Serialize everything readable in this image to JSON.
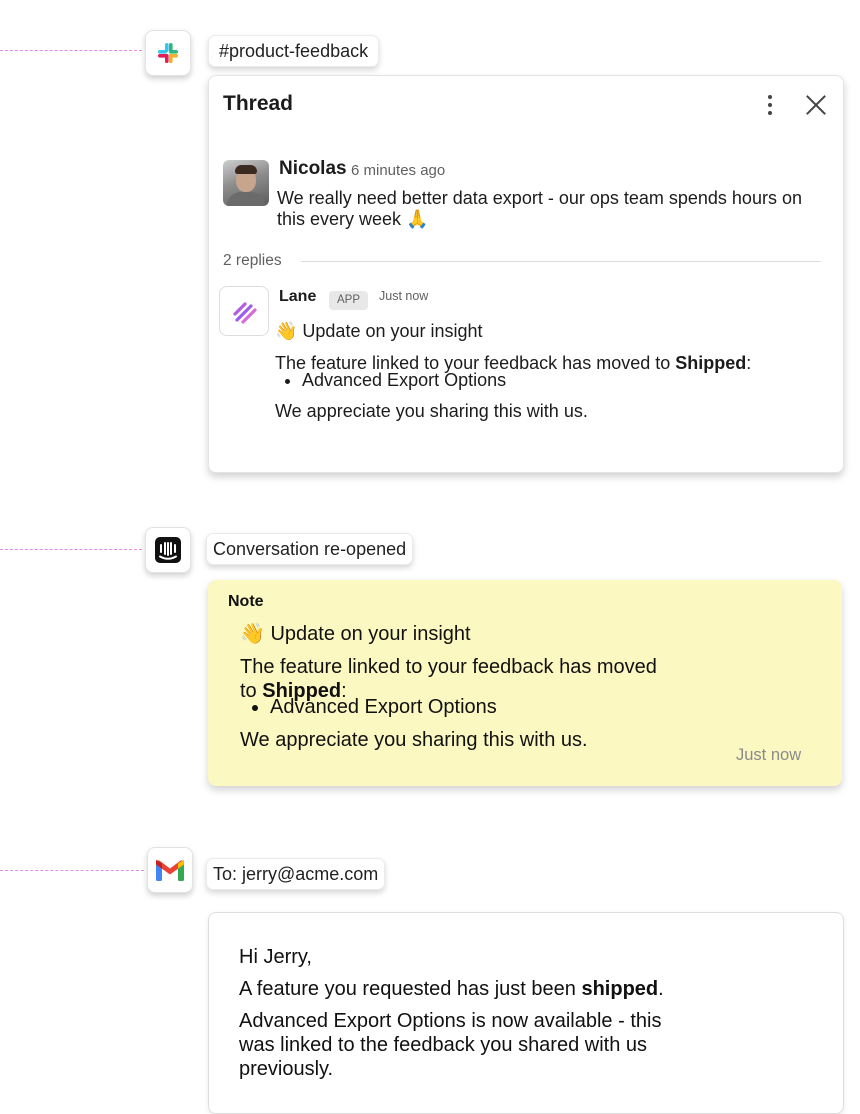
{
  "slack": {
    "channel": "#product-feedback",
    "icon": "slack-logo-icon",
    "thread": {
      "title": "Thread",
      "original": {
        "author": "Nicolas",
        "time": "6 minutes ago",
        "text": "We really need better data export - our ops team spends hours on this every week 🙏"
      },
      "replies_label": "2 replies",
      "reply": {
        "author": "Lane",
        "badge": "APP",
        "time": "Just now",
        "heading": "👋 Update on your insight",
        "line_prefix": "The feature linked to your feedback has moved to ",
        "status": "Shipped",
        "line_suffix": ":",
        "bullet": "Advanced Export Options",
        "closing": "We appreciate you sharing this with us."
      }
    }
  },
  "intercom": {
    "event": "Conversation re-opened",
    "icon": "intercom-logo-icon",
    "note": {
      "label": "Note",
      "heading": "👋 Update on your insight",
      "line_prefix": "The feature linked to your feedback has moved to ",
      "status": "Shipped",
      "line_suffix": ":",
      "bullet": "Advanced Export Options",
      "closing": "We appreciate you sharing this with us.",
      "time": "Just now"
    }
  },
  "gmail": {
    "to": "To: jerry@acme.com",
    "icon": "gmail-logo-icon",
    "email": {
      "greeting": "Hi Jerry,",
      "line1_prefix": "A feature you requested has just been ",
      "line1_bold": "shipped",
      "line1_suffix": ".",
      "line2": "Advanced Export Options is now available - this was linked to the feedback you shared with us previously."
    }
  },
  "colors": {
    "connector": "#e58ae6",
    "note_bg": "#fcf8c1"
  }
}
